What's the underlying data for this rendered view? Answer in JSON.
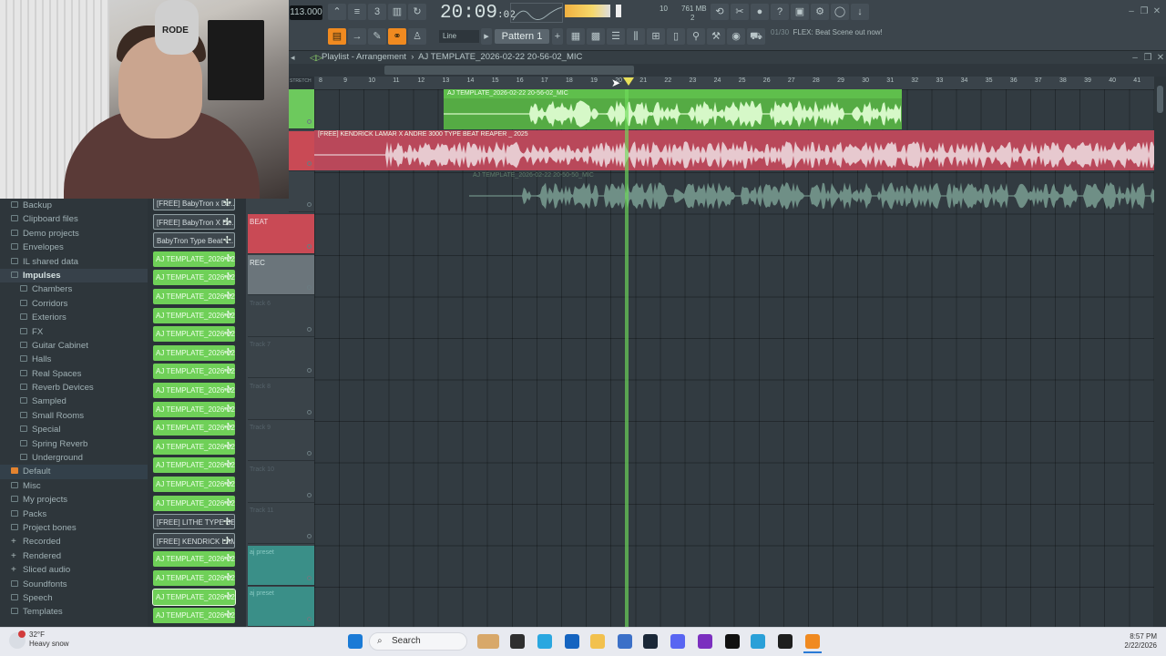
{
  "toolbar": {
    "tempo": "113.000",
    "time_main": "20:09",
    "time_sub": ":02",
    "cpu_value": "10",
    "memory": "761 MB",
    "cpu_sub": "2",
    "snap": "Line",
    "pattern": "Pattern 1",
    "hint_index": "01/30",
    "hint_text": "FLEX: Beat Scene out now!"
  },
  "playlist": {
    "title": "Playlist - Arrangement",
    "project": "AJ TEMPLATE_2026-02-22 20-56-02_MIC",
    "ruler_label": "STRETCH",
    "ruler": [
      "8",
      "9",
      "10",
      "11",
      "12",
      "13",
      "14",
      "15",
      "16",
      "17",
      "18",
      "19",
      "20",
      "21",
      "22",
      "23",
      "24",
      "25",
      "26",
      "27",
      "28",
      "29",
      "30",
      "31",
      "32",
      "33",
      "34",
      "35",
      "36",
      "37",
      "38",
      "39",
      "40",
      "41"
    ],
    "clips": [
      {
        "title": "AJ TEMPLATE_2026-02-22 20-56-02_MIC"
      },
      {
        "title": "[FREE] KENDRICK LAMAR X ANDRE 3000 TYPE BEAT REAPER _ 2025"
      },
      {
        "title": "AJ TEMPLATE_2026-02-22 20-50-50_MIC"
      }
    ],
    "tracks": [
      "",
      "",
      "",
      "BEAT",
      "REC",
      "Track 6",
      "Track 7",
      "Track 8",
      "Track 9",
      "Track 10",
      "Track 11",
      "aj preset",
      "aj preset"
    ]
  },
  "browser": {
    "items": [
      {
        "label": "Backup",
        "icon": "folder"
      },
      {
        "label": "Clipboard files",
        "icon": "folder"
      },
      {
        "label": "Demo projects",
        "icon": "folder"
      },
      {
        "label": "Envelopes",
        "icon": "folder"
      },
      {
        "label": "IL shared data",
        "icon": "folder"
      },
      {
        "label": "Impulses",
        "icon": "folder-open"
      },
      {
        "label": "Chambers",
        "icon": "folder"
      },
      {
        "label": "Corridors",
        "icon": "folder"
      },
      {
        "label": "Exteriors",
        "icon": "folder"
      },
      {
        "label": "FX",
        "icon": "folder"
      },
      {
        "label": "Guitar Cabinet",
        "icon": "folder"
      },
      {
        "label": "Halls",
        "icon": "folder"
      },
      {
        "label": "Real Spaces",
        "icon": "folder"
      },
      {
        "label": "Reverb Devices",
        "icon": "folder"
      },
      {
        "label": "Sampled",
        "icon": "folder"
      },
      {
        "label": "Small Rooms",
        "icon": "folder"
      },
      {
        "label": "Special",
        "icon": "folder"
      },
      {
        "label": "Spring Reverb",
        "icon": "folder"
      },
      {
        "label": "Underground",
        "icon": "folder"
      },
      {
        "label": "Default",
        "icon": "preset"
      },
      {
        "label": "Misc",
        "icon": "folder"
      },
      {
        "label": "My projects",
        "icon": "folder"
      },
      {
        "label": "Packs",
        "icon": "packs"
      },
      {
        "label": "Project bones",
        "icon": "folder"
      },
      {
        "label": "Recorded",
        "icon": "plus"
      },
      {
        "label": "Rendered",
        "icon": "plus"
      },
      {
        "label": "Sliced audio",
        "icon": "plus"
      },
      {
        "label": "Soundfonts",
        "icon": "folder"
      },
      {
        "label": "Speech",
        "icon": "folder"
      },
      {
        "label": "Templates",
        "icon": "folder"
      }
    ]
  },
  "picker": {
    "clips": [
      {
        "label": "[FREE] BabyTron x De...",
        "style": "gray"
      },
      {
        "label": "[FREE] BabyTron X De...",
        "style": "gray"
      },
      {
        "label": "BabyTron Type Beat -...",
        "style": "gray"
      },
      {
        "label": "AJ TEMPLATE_2026-02-2...",
        "style": "green"
      },
      {
        "label": "AJ TEMPLATE_2026-02-2...",
        "style": "green"
      },
      {
        "label": "AJ TEMPLATE_2026-02-2...",
        "style": "green"
      },
      {
        "label": "AJ TEMPLATE_2026-02-2...",
        "style": "green"
      },
      {
        "label": "AJ TEMPLATE_2026-02-2...",
        "style": "green"
      },
      {
        "label": "AJ TEMPLATE_2026-02-2...",
        "style": "green"
      },
      {
        "label": "AJ TEMPLATE_2026-02-2...",
        "style": "green"
      },
      {
        "label": "AJ TEMPLATE_2026-02-2...",
        "style": "green"
      },
      {
        "label": "AJ TEMPLATE_2026-02-2...",
        "style": "green"
      },
      {
        "label": "AJ TEMPLATE_2026-02-2...",
        "style": "green"
      },
      {
        "label": "AJ TEMPLATE_2026-02-2...",
        "style": "green"
      },
      {
        "label": "AJ TEMPLATE_2026-02-2...",
        "style": "green"
      },
      {
        "label": "AJ TEMPLATE_2026-02-2...",
        "style": "green"
      },
      {
        "label": "AJ TEMPLATE_2026-02-2...",
        "style": "green"
      },
      {
        "label": "[FREE] LITHE TYPE BE...",
        "style": "gray"
      },
      {
        "label": "[FREE] KENDRICK LAM...",
        "style": "gray"
      },
      {
        "label": "AJ TEMPLATE_2026-02-2...",
        "style": "green"
      },
      {
        "label": "AJ TEMPLATE_2026-02-2...",
        "style": "green"
      },
      {
        "label": "AJ TEMPLATE_2026-02-2...",
        "style": "green"
      },
      {
        "label": "AJ TEMPLATE_2026-02-2...",
        "style": "green"
      }
    ]
  },
  "webcam": {
    "mic_brand": "RODE"
  },
  "taskbar": {
    "weather_temp": "32°F",
    "weather_desc": "Heavy snow",
    "search": "Search",
    "time": "8:57 PM",
    "date": "2/22/2026"
  },
  "colors": {
    "accent_green": "#6fd058",
    "beat_red": "#c94a55",
    "orange": "#f08a20"
  }
}
